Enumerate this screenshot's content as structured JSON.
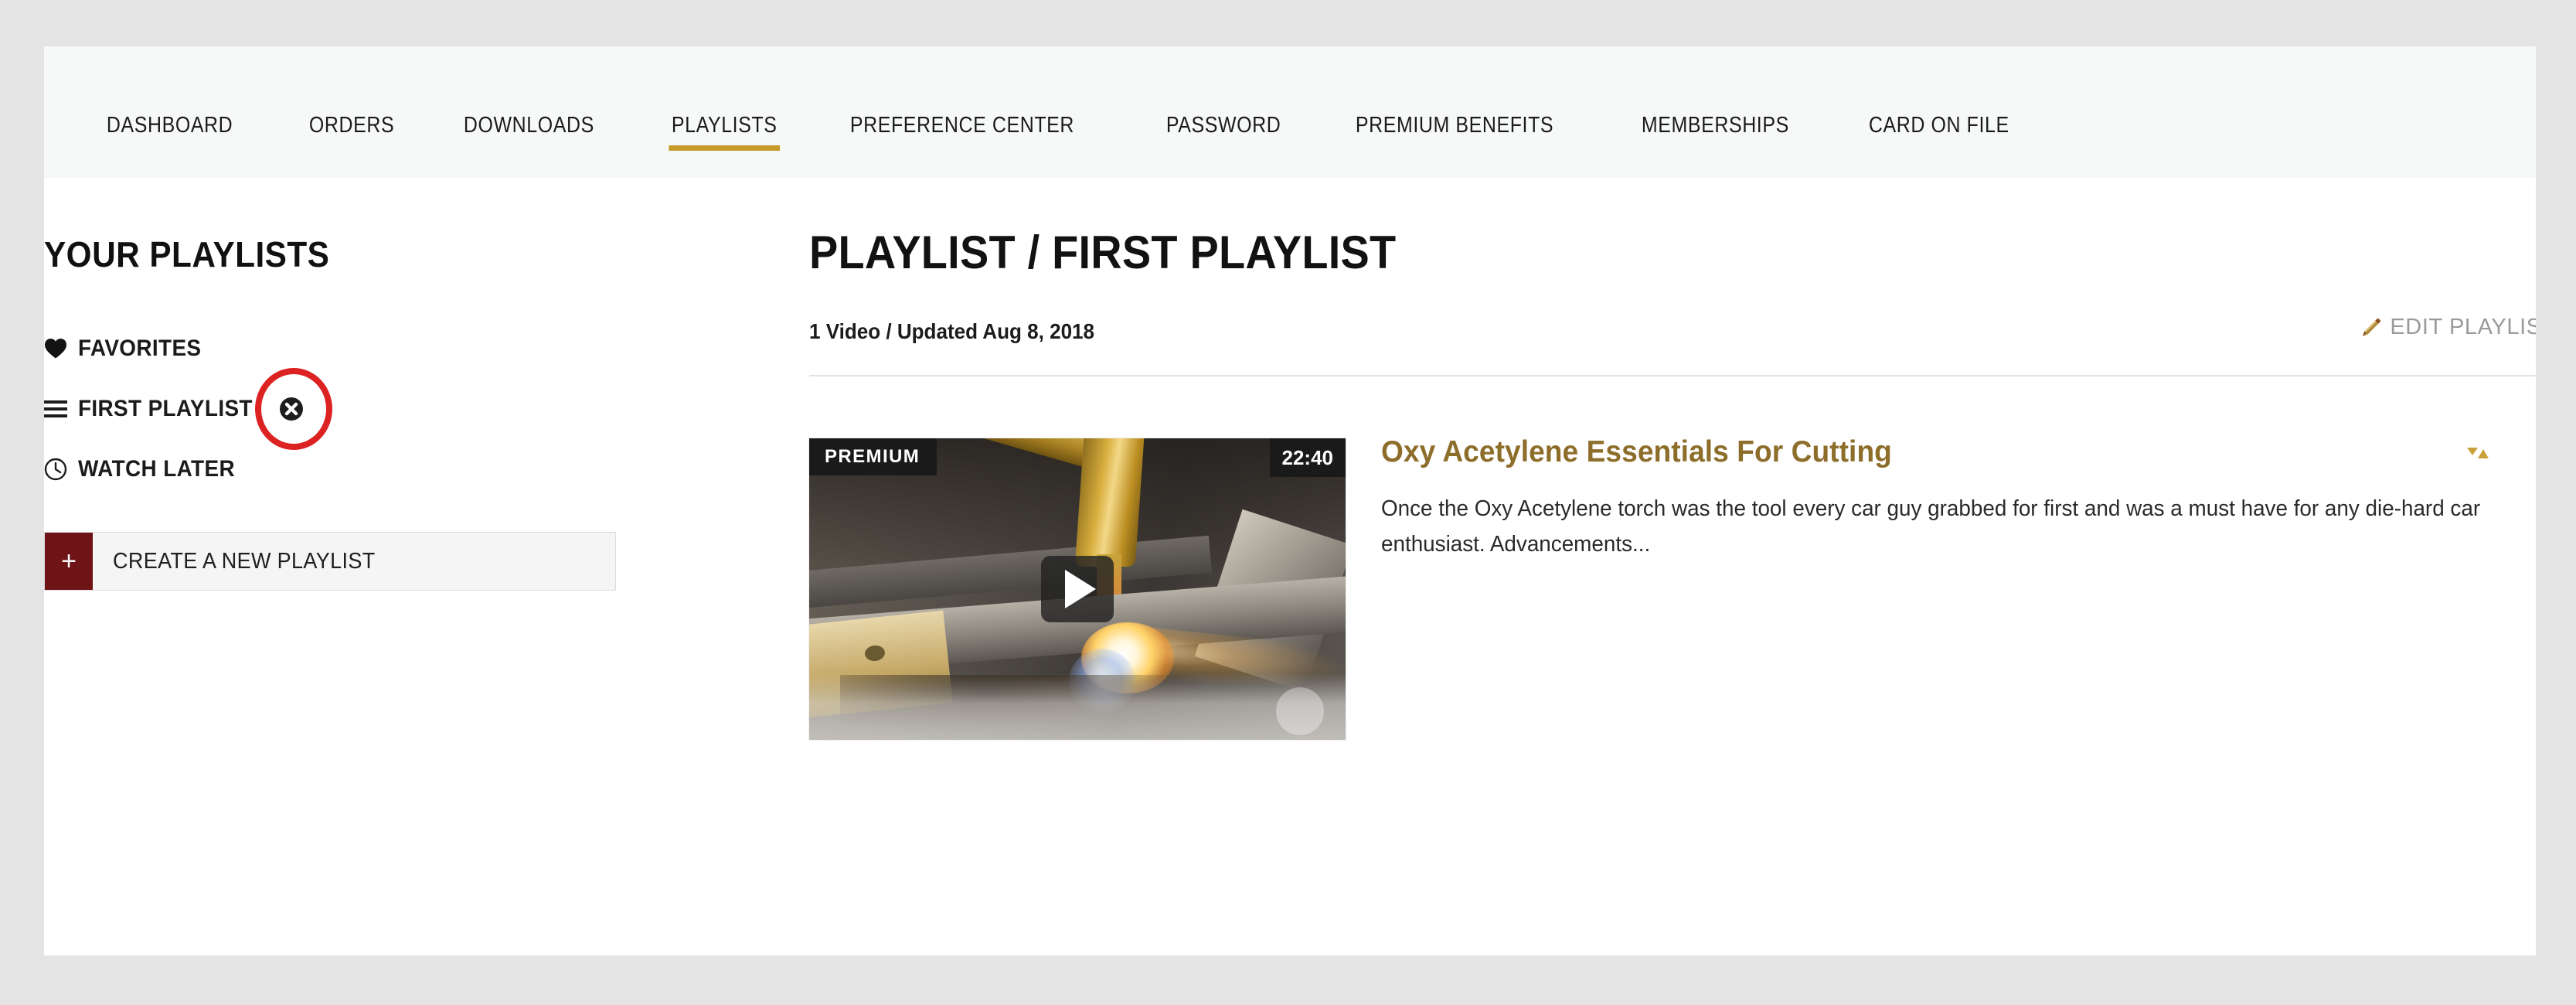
{
  "nav": {
    "items": [
      {
        "label": "DASHBOARD",
        "active": false
      },
      {
        "label": "ORDERS",
        "active": false
      },
      {
        "label": "DOWNLOADS",
        "active": false
      },
      {
        "label": "PLAYLISTS",
        "active": true
      },
      {
        "label": "PREFERENCE CENTER",
        "active": false
      },
      {
        "label": "PASSWORD",
        "active": false
      },
      {
        "label": "PREMIUM BENEFITS",
        "active": false
      },
      {
        "label": "MEMBERSHIPS",
        "active": false
      },
      {
        "label": "CARD ON FILE",
        "active": false
      }
    ]
  },
  "sidebar": {
    "title": "YOUR PLAYLISTS",
    "items": [
      {
        "label": "FAVORITES",
        "icon": "heart-icon",
        "deletable": false
      },
      {
        "label": "FIRST PLAYLIST",
        "icon": "list-icon",
        "deletable": true
      },
      {
        "label": "WATCH LATER",
        "icon": "clock-icon",
        "deletable": false
      }
    ],
    "create_button": {
      "label": "CREATE A NEW PLAYLIST",
      "plus": "+"
    }
  },
  "main": {
    "heading": "PLAYLIST / FIRST PLAYLIST",
    "meta": "1 Video / Updated Aug 8, 2018",
    "edit_link": "EDIT PLAYLIST",
    "edit_icon": "pencil-icon",
    "video": {
      "badge": "PREMIUM",
      "duration": "22:40",
      "title": "Oxy Acetylene Essentials For Cutting",
      "description": "Once the Oxy Acetylene torch was the tool every car guy grabbed for first and was a must have for any die-hard car enthusiast. Advancements...",
      "play_icon": "play-icon",
      "sort_icon": "sort-arrows-icon"
    }
  },
  "colors": {
    "accent_gold": "#c49a28",
    "link_gold": "#8d6d2a",
    "brand_maroon": "#6e1316",
    "annotation_red": "#dd2222",
    "nav_bg": "#f7f8f8",
    "page_bg": "#e4e4e4",
    "muted_gray": "#9a9a9a"
  }
}
